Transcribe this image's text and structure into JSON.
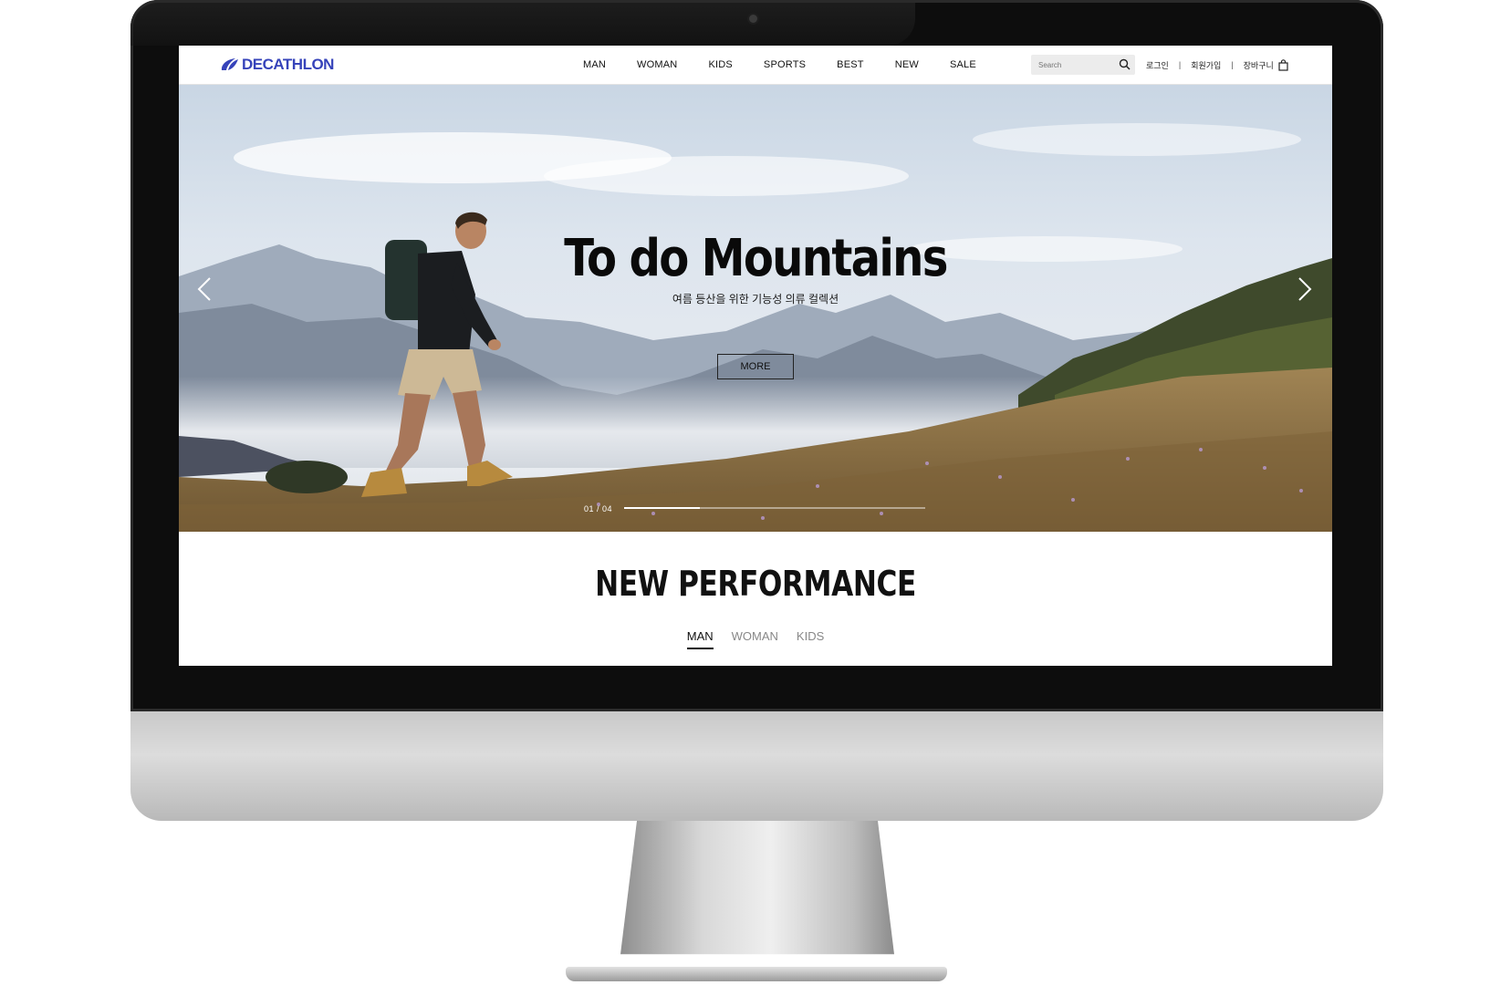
{
  "site": {
    "logo_text": "DECATHLON",
    "brand_color": "#3643ba"
  },
  "nav": {
    "items": [
      {
        "label": "MAN"
      },
      {
        "label": "WOMAN"
      },
      {
        "label": "KIDS"
      },
      {
        "label": "SPORTS"
      },
      {
        "label": "BEST"
      },
      {
        "label": "NEW"
      },
      {
        "label": "SALE"
      }
    ]
  },
  "search": {
    "placeholder": "Search",
    "icon": "search-icon"
  },
  "util": {
    "login": "로그인",
    "signup": "회원가입",
    "cart": "장바구니",
    "separator": "|",
    "cart_icon": "shopping-bag-icon"
  },
  "hero": {
    "title": "To do Mountains",
    "subtitle": "여름 등산을 위한 기능성 의류 컬렉션",
    "button": "MORE",
    "counter": "01 / 04",
    "slide_progress": 0.25
  },
  "section": {
    "title": "NEW PERFORMANCE",
    "tabs": [
      {
        "label": "MAN",
        "active": true
      },
      {
        "label": "WOMAN",
        "active": false
      },
      {
        "label": "KIDS",
        "active": false
      }
    ]
  }
}
